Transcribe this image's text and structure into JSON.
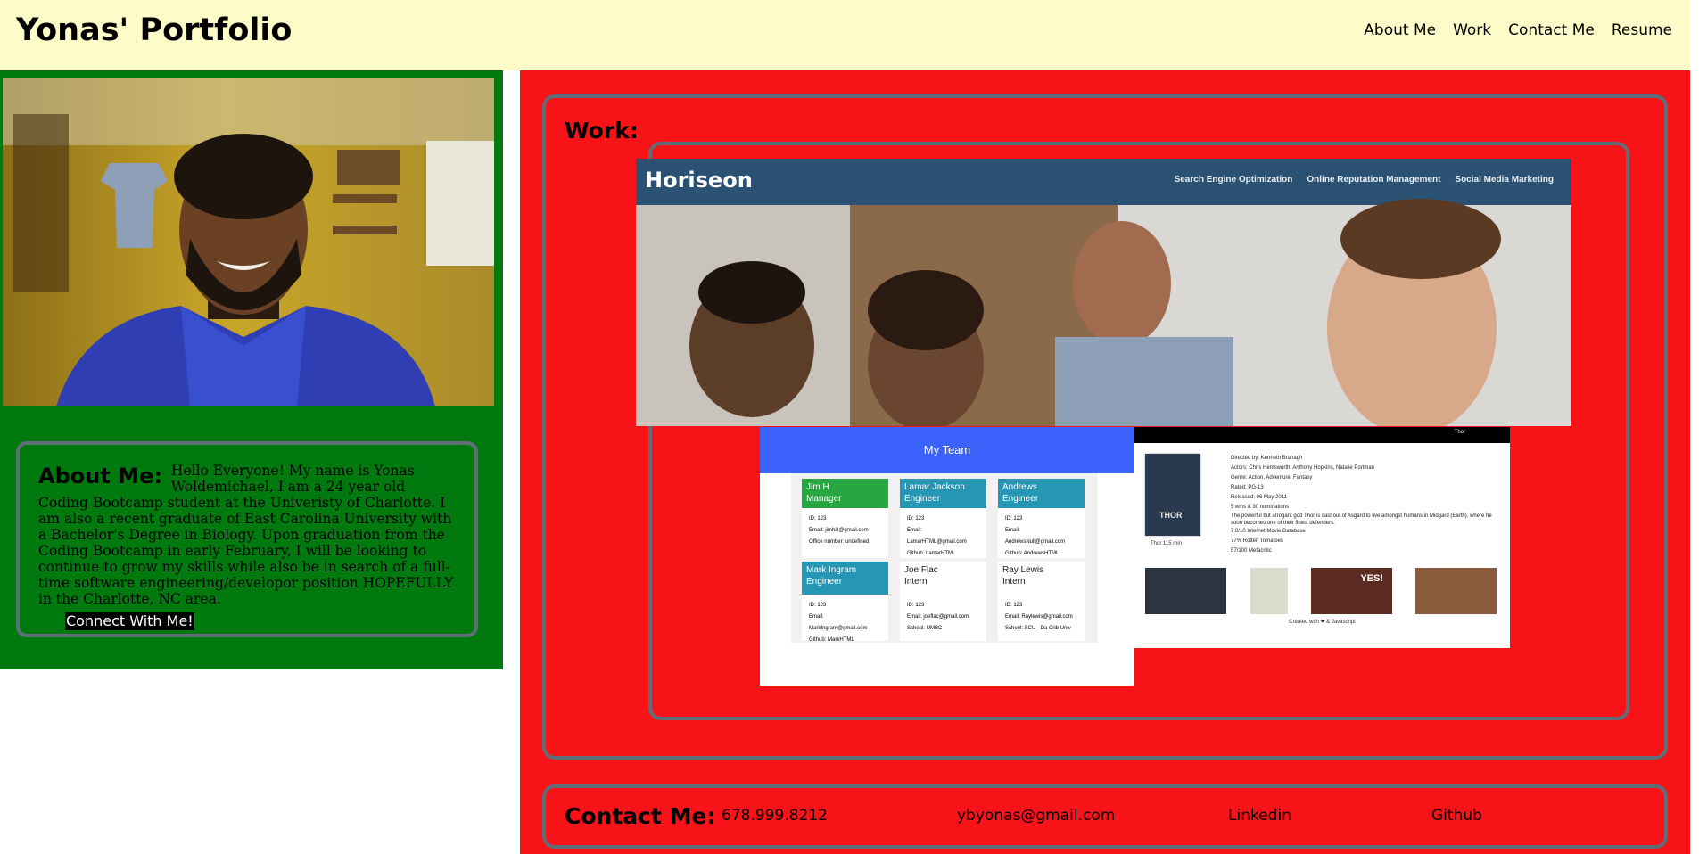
{
  "header": {
    "title": "Yonas' Portfolio",
    "nav": [
      "About Me",
      "Work",
      "Contact Me",
      "Resume"
    ]
  },
  "about": {
    "heading": "About Me:",
    "text": "Hello Everyone! My name is Yonas Woldemichael, I am a 24 year old Coding Bootcamp student at the Univeristy of Charlotte. I am also a recent graduate of East Carolina University with a Bachelor's Degree in Biology. Upon graduation from the Coding Bootcamp in early February, I will be looking to continue to grow my skills while also be in search of a full-time software engineering/developor position HOPEFULLY in the Charlotte, NC area.",
    "connect_button": "Connect With Me!"
  },
  "work": {
    "heading": "Work:",
    "horiseon": {
      "logo": "Horiseon",
      "nav": [
        "Search Engine Optimization",
        "Online Reputation Management",
        "Social Media Marketing"
      ]
    },
    "team": {
      "title": "My Team",
      "members": [
        {
          "name": "Jim H",
          "role": "Manager",
          "id": "ID: 123",
          "email": "Email: jimhill@gmail.com",
          "extra": "Office number: undefined"
        },
        {
          "name": "Lamar Jackson",
          "role": "Engineer",
          "id": "ID: 123",
          "email": "Email: LamarHTML@gmail.com",
          "extra": "Github: LamarHTML"
        },
        {
          "name": "Andrews",
          "role": "Engineer",
          "id": "ID: 123",
          "email": "Email: AndrewsNull@gmail.com",
          "extra": "Github: AndrewsHTML"
        },
        {
          "name": "Mark Ingram",
          "role": "Engineer",
          "id": "ID: 123",
          "email": "Email: MarkIngram@gmail.com",
          "extra": "Github: MarkHTML"
        },
        {
          "name": "Joe Flac",
          "role": "Intern",
          "id": "ID: 123",
          "email": "Email: joeflac@gmail.com",
          "extra": "School: UMBC"
        },
        {
          "name": "Ray Lewis",
          "role": "Intern",
          "id": "ID: 123",
          "email": "Email: Raylewis@gmail.com",
          "extra": "School: SCU - Da Crib Univ"
        }
      ]
    },
    "movie": {
      "search_value": "Thor",
      "details": [
        "Directed by: Kenneth Branagh",
        "Actors: Chris Hemsworth, Anthony Hopkins, Natalie Portman",
        "Genre: Action, Adventure, Fantasy",
        "Rated: PG-13",
        "Released: 06 May 2011",
        "5 wins & 30 nominations",
        "The powerful but arrogant god Thor is cast out of Asgard to live amongst humans in Midgard (Earth), where he soon becomes one of their finest defenders.",
        "7.0/10 Internet Movie Database",
        "77% Rotten Tomatoes",
        "57/100 Metacritic"
      ],
      "poster_title": "THOR",
      "poster_caption": "Thor 115 min",
      "gif_text": "YES!",
      "footer": "Created with ❤ & Javascript"
    }
  },
  "contact": {
    "heading": "Contact Me:",
    "phone": "678.999.8212",
    "email": "ybyonas@gmail.com",
    "linkedin": "Linkedin",
    "github": "Github"
  },
  "colors": {
    "header_bg": "#fdfbc7",
    "left_panel_bg": "#007a0e",
    "right_panel_bg": "#f71317",
    "card_border": "#5f6e78"
  }
}
